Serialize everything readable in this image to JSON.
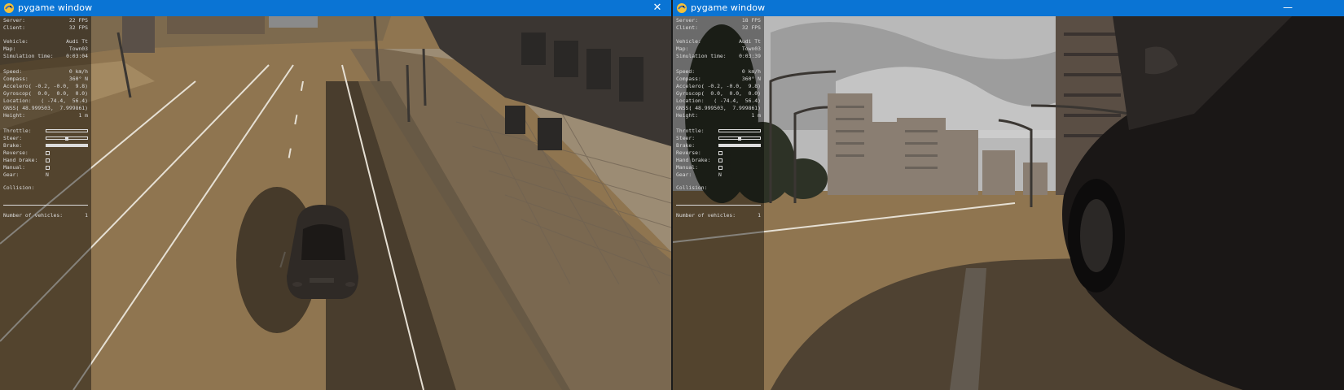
{
  "windows": [
    {
      "title": "pygame window",
      "hud": {
        "server": {
          "label": "Server:",
          "value": "22 FPS"
        },
        "client": {
          "label": "Client:",
          "value": "32 FPS"
        },
        "vehicle": {
          "label": "Vehicle:",
          "value": "Audi Tt"
        },
        "map": {
          "label": "Map:",
          "value": "Town03"
        },
        "sim_time": {
          "label": "Simulation time:",
          "value": "0:03:04"
        },
        "speed": {
          "label": "Speed:",
          "value": "0 km/h"
        },
        "compass": {
          "label": "Compass:",
          "value": "360° N"
        },
        "accelero": {
          "label": "Accelero:",
          "value": "( -0.2, -0.0,  9.8)"
        },
        "gyroscop": {
          "label": "Gyroscop:",
          "value": "(  0.0,  0.0,  0.0)"
        },
        "location": {
          "label": "Location:",
          "value": "( -74.4,  56.4)"
        },
        "gnss": {
          "label": "GNSS:",
          "value": "( 48.999503,  7.999861)"
        },
        "height": {
          "label": "Height:",
          "value": "1 m"
        },
        "throttle": {
          "label": "Throttle:",
          "level": 0
        },
        "steer": {
          "label": "Steer:",
          "level": 0.5
        },
        "brake": {
          "label": "Brake:",
          "level": 1
        },
        "reverse": {
          "label": "Reverse:",
          "on": false
        },
        "hand_brake": {
          "label": "Hand brake:",
          "on": false
        },
        "manual": {
          "label": "Manual:",
          "on": false
        },
        "gear": {
          "label": "Gear:",
          "value": "N"
        },
        "collision": {
          "label": "Collision:"
        },
        "num_vehicles": {
          "label": "Number of vehicles:",
          "value": "1"
        }
      }
    },
    {
      "title": "pygame window",
      "hud": {
        "server": {
          "label": "Server:",
          "value": "18 FPS"
        },
        "client": {
          "label": "Client:",
          "value": "32 FPS"
        },
        "vehicle": {
          "label": "Vehicle:",
          "value": "Audi Tt"
        },
        "map": {
          "label": "Map:",
          "value": "Town03"
        },
        "sim_time": {
          "label": "Simulation time:",
          "value": "0:03:39"
        },
        "speed": {
          "label": "Speed:",
          "value": "0 km/h"
        },
        "compass": {
          "label": "Compass:",
          "value": "360° N"
        },
        "accelero": {
          "label": "Accelero:",
          "value": "( -0.2, -0.0,  9.8)"
        },
        "gyroscop": {
          "label": "Gyroscop:",
          "value": "(  0.0,  0.0,  0.0)"
        },
        "location": {
          "label": "Location:",
          "value": "( -74.4,  56.4)"
        },
        "gnss": {
          "label": "GNSS:",
          "value": "( 48.999503,  7.999861)"
        },
        "height": {
          "label": "Height:",
          "value": "1 m"
        },
        "throttle": {
          "label": "Throttle:",
          "level": 0
        },
        "steer": {
          "label": "Steer:",
          "level": 0.5
        },
        "brake": {
          "label": "Brake:",
          "level": 1
        },
        "reverse": {
          "label": "Reverse:",
          "on": false
        },
        "hand_brake": {
          "label": "Hand brake:",
          "on": false
        },
        "manual": {
          "label": "Manual:",
          "on": false
        },
        "gear": {
          "label": "Gear:",
          "value": "N"
        },
        "collision": {
          "label": "Collision:"
        },
        "num_vehicles": {
          "label": "Number of vehicles:",
          "value": "1"
        }
      }
    }
  ],
  "icons": {
    "window_icon": "pygame-snake-icon",
    "close": "close-icon",
    "minimize": "minimize-icon"
  },
  "colors": {
    "titlebar": "#0a74d4",
    "road": "#8f7550",
    "sky": "#b9b9b9",
    "hud_text": "#dcdcdc"
  }
}
